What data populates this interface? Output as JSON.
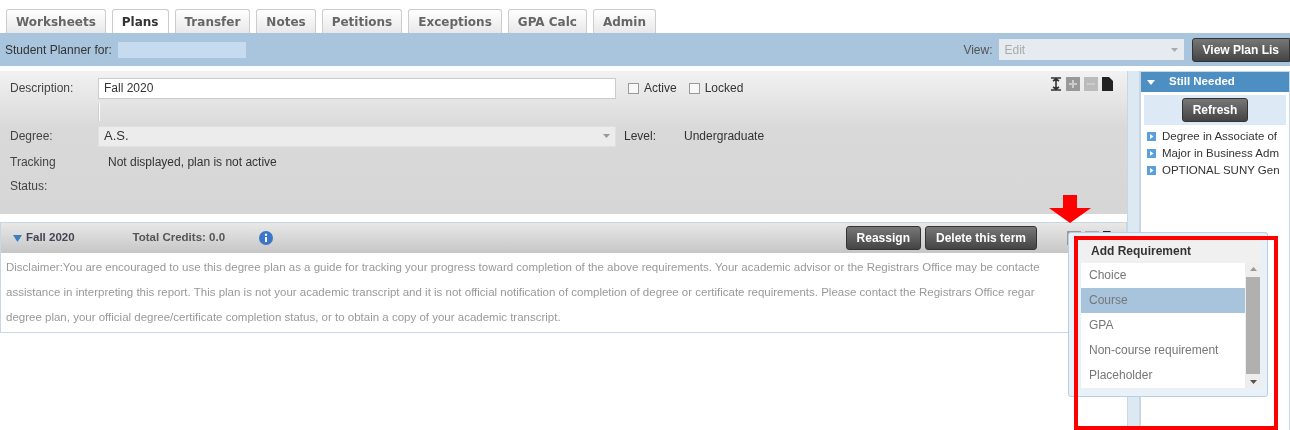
{
  "tabs": [
    {
      "label": "Worksheets",
      "selected": false
    },
    {
      "label": "Plans",
      "selected": true
    },
    {
      "label": "Transfer",
      "selected": false
    },
    {
      "label": "Notes",
      "selected": false
    },
    {
      "label": "Petitions",
      "selected": false
    },
    {
      "label": "Exceptions",
      "selected": false
    },
    {
      "label": "GPA Calc",
      "selected": false
    },
    {
      "label": "Admin",
      "selected": false
    }
  ],
  "header": {
    "title": "Student Planner for:",
    "view_label": "View:",
    "view_value": "Edit",
    "view_disabled": true,
    "button": "View Plan Lis"
  },
  "plan": {
    "description_label": "Description:",
    "description": "Fall 2020",
    "active_label": "Active",
    "active": false,
    "locked_label": "Locked",
    "locked": false,
    "degree_label": "Degree:",
    "degree": "A.S.",
    "level_label": "Level:",
    "level_value": "Undergraduate",
    "tracking_label": "Tracking",
    "tracking_value": "Not displayed, plan is not active",
    "status_label": "Status:"
  },
  "term": {
    "title": "Fall 2020",
    "expanded": true,
    "credits": "Total Credits: 0.0",
    "buttons": [
      "Reassign",
      "Delete this term"
    ],
    "disclaimer": [
      "Disclaimer:You are encouraged to use this degree plan as a guide for tracking your progress toward completion of the above requirements. Your academic advisor or the Registrars Office may be contacte",
      "assistance in interpreting this report. This plan is not your academic transcript and it is not official notification of completion of degree or certificate requirements. Please contact the Registrars Office regar",
      "degree plan, your official degree/certificate completion status, or to obtain a copy of your academic transcript."
    ]
  },
  "still_needed": {
    "title": "Still Needed",
    "expanded": true,
    "button": "Refresh",
    "items": [
      "Degree in Associate of",
      "Major in Business Adm",
      "OPTIONAL SUNY Gen"
    ]
  },
  "add_requirement": {
    "title": "Add Requirement",
    "options": [
      {
        "label": "Choice",
        "selected": false
      },
      {
        "label": "Course",
        "selected": true
      },
      {
        "label": "GPA",
        "selected": false
      },
      {
        "label": "Non-course requirement",
        "selected": false
      },
      {
        "label": "Placeholder",
        "selected": false
      }
    ]
  }
}
